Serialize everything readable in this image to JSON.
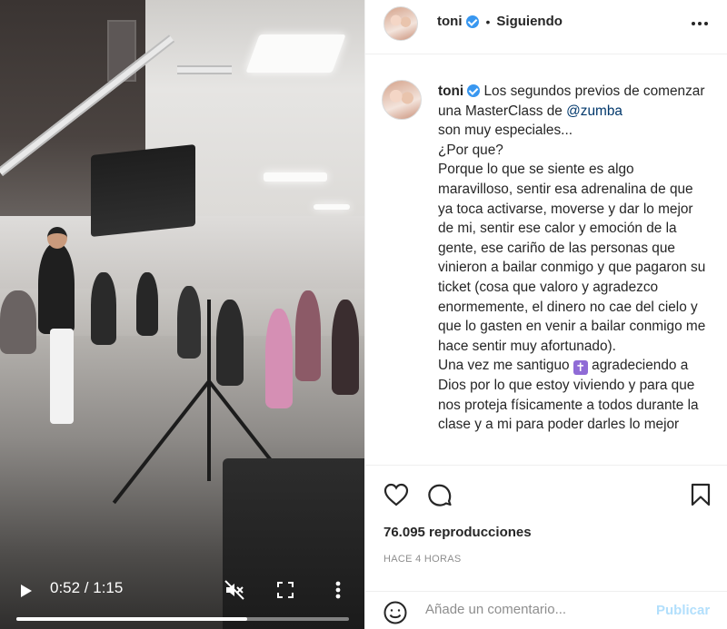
{
  "video": {
    "current_time": "0:52",
    "duration": "1:15",
    "time_display": "0:52 / 1:15",
    "progress": 0.693,
    "icons": [
      "play-icon",
      "mute-icon",
      "fullscreen-icon",
      "more-vertical-icon"
    ]
  },
  "header": {
    "username": "toni",
    "separator": "•",
    "follow_status": "Siguiendo",
    "more_icon": "more-horizontal-icon"
  },
  "caption": {
    "username": "toni",
    "text_1": "Los segundos previos de comenzar una MasterClass de",
    "mention": "@zumba",
    "text_2": "son muy especiales...",
    "text_3": "¿Por que?",
    "text_4": "Porque lo que se siente es algo maravilloso, sentir esa adrenalina de que ya toca activarse, moverse y dar lo mejor de mi, sentir ese calor y emoción de la gente, ese cariño de las personas que vinieron a bailar conmigo y que pagaron su ticket (cosa que valoro y agradezco enormemente, el dinero no cae del cielo y que lo gasten en venir a bailar conmigo me hace sentir muy afortunado).",
    "text_5a": "Una vez me santiguo",
    "emoji": "✝",
    "text_5b": "agradeciendo a Dios por lo que estoy viviendo y para que nos proteja físicamente a todos durante la clase y a mi para poder darles lo mejor"
  },
  "actions": {
    "icons": [
      "heart-icon",
      "comment-icon",
      "bookmark-icon"
    ]
  },
  "stats": {
    "views": "76.095 reproducciones",
    "time_ago": "HACE 4 HORAS"
  },
  "comment": {
    "placeholder": "Añade un comentario...",
    "post_label": "Publicar",
    "emoji_icon": "smile-icon"
  },
  "colors": {
    "verified": "#3897f0",
    "mention": "#00376b",
    "post_disabled": "#b2dffc",
    "muted_text": "#8e8e8e"
  }
}
